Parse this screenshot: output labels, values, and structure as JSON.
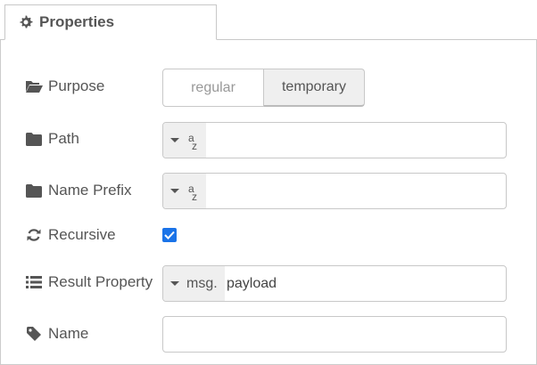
{
  "tab": {
    "label": "Properties",
    "icon": "gear-icon"
  },
  "fields": {
    "purpose": {
      "label": "Purpose",
      "icon": "folder-open-icon",
      "options": [
        "regular",
        "temporary"
      ],
      "selected": "temporary"
    },
    "path": {
      "label": "Path",
      "icon": "folder-icon",
      "type_icon": "string-type-icon",
      "value": ""
    },
    "name_prefix": {
      "label": "Name Prefix",
      "icon": "folder-icon",
      "type_icon": "string-type-icon",
      "value": ""
    },
    "recursive": {
      "label": "Recursive",
      "icon": "refresh-icon",
      "checked": true
    },
    "result_property": {
      "label": "Result Property",
      "icon": "list-icon",
      "type": "msg.",
      "value": "payload"
    },
    "name": {
      "label": "Name",
      "icon": "tag-icon",
      "value": ""
    }
  },
  "colors": {
    "accent": "#1a73e8",
    "border": "#c8c8c8",
    "selected_bg": "#efefef"
  }
}
